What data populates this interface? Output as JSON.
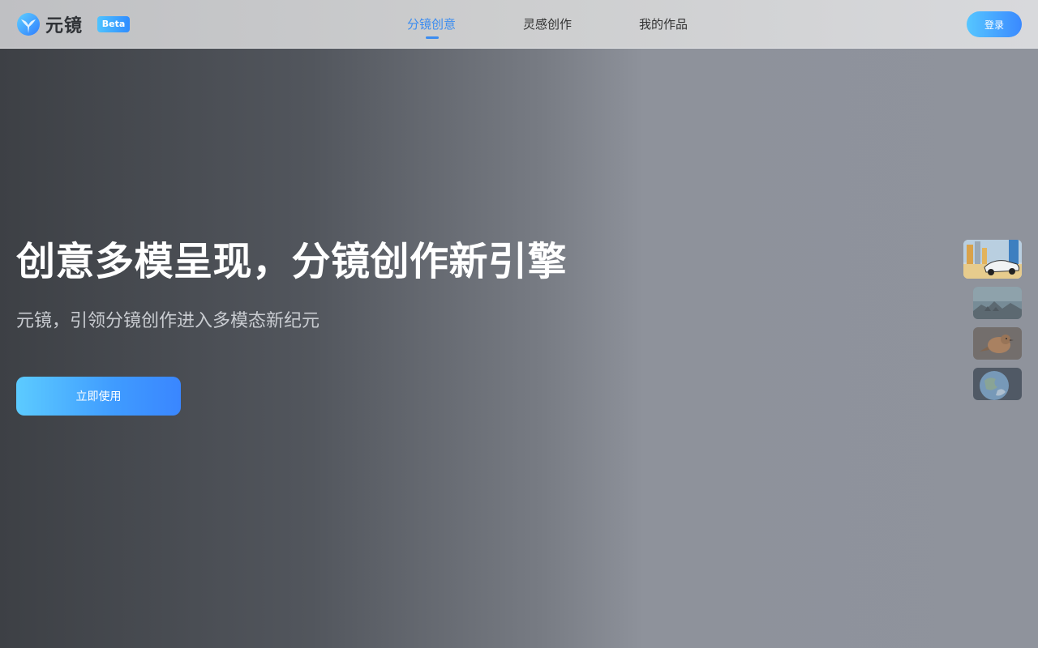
{
  "header": {
    "brand": "元镜",
    "badge": "Beta",
    "nav": [
      {
        "label": "分镜创意",
        "active": true
      },
      {
        "label": "灵感创作",
        "active": false
      },
      {
        "label": "我的作品",
        "active": false
      }
    ],
    "login_label": "登录"
  },
  "hero": {
    "title": "创意多模呈现，分镜创作新引擎",
    "subtitle": "元镜，引领分镜创作进入多模态新纪元",
    "cta_label": "立即使用"
  },
  "thumbnails": [
    {
      "icon": "car-city-thumbnail",
      "active": true
    },
    {
      "icon": "mountain-landscape-thumbnail",
      "active": false
    },
    {
      "icon": "bird-thumbnail",
      "active": false
    },
    {
      "icon": "earth-thumbnail",
      "active": false
    }
  ],
  "colors": {
    "accent": "#3b8cf0",
    "button_start": "#56c6ff",
    "button_end": "#3a89ff",
    "title": "#ffffff",
    "subtitle": "#c9ccd1"
  }
}
